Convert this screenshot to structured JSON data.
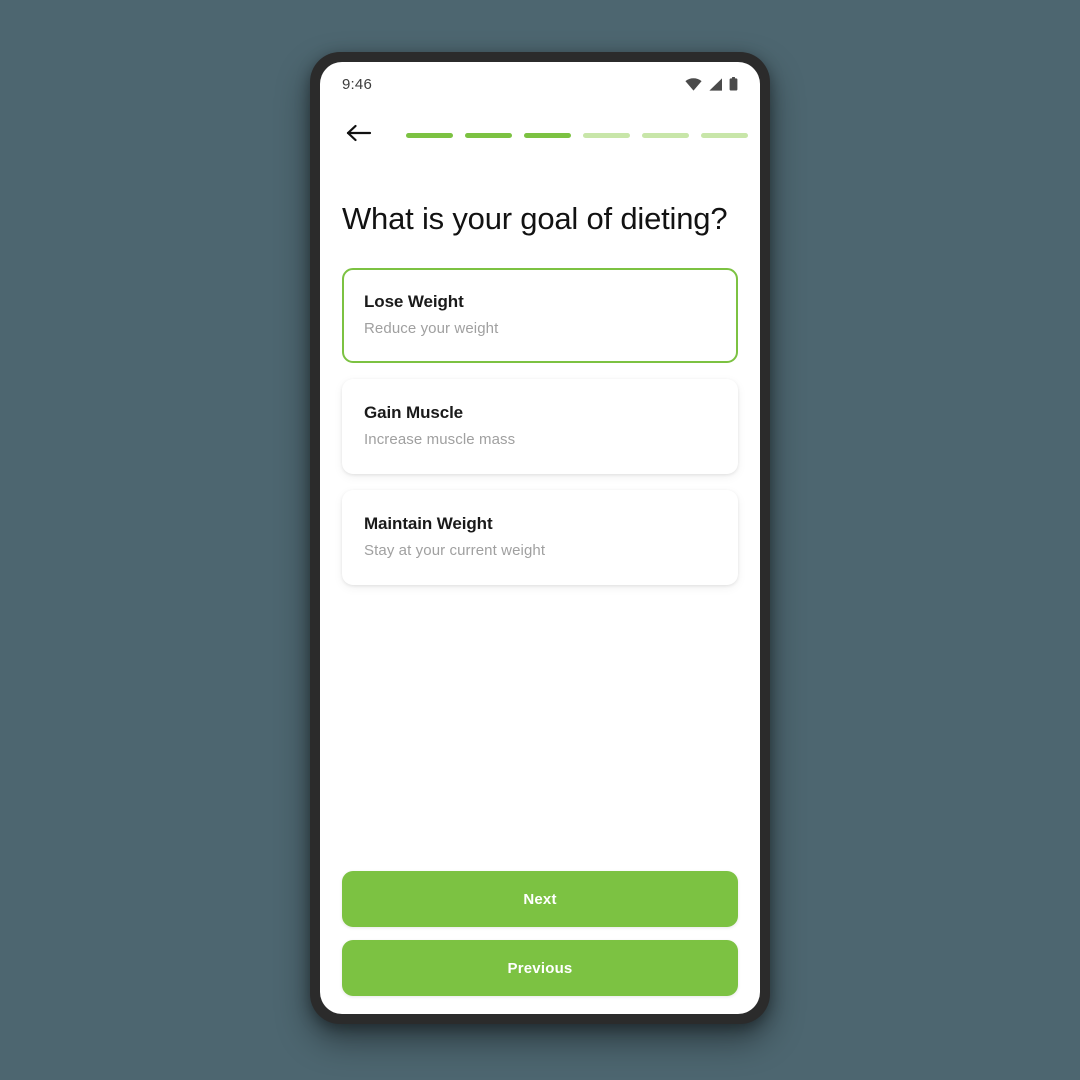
{
  "theme": {
    "page_background": "#4D6670",
    "accent_green": "#7CC242",
    "accent_green_muted": "#C8E6A9",
    "title_color": "#121212",
    "subtitle_color": "#A0A0A0"
  },
  "status_bar": {
    "time": "9:46",
    "icons": [
      "wifi-icon",
      "cellular-signal-icon",
      "battery-icon"
    ]
  },
  "top_bar": {
    "back_icon": "arrow-left-icon",
    "progress": {
      "total_steps": 6,
      "completed_steps": 3,
      "segments": [
        true,
        true,
        true,
        false,
        false,
        false
      ]
    }
  },
  "main": {
    "title": "What is your goal of dieting?",
    "options": [
      {
        "title": "Lose Weight",
        "subtitle": "Reduce your weight",
        "selected": true
      },
      {
        "title": "Gain Muscle",
        "subtitle": "Increase muscle mass",
        "selected": false
      },
      {
        "title": "Maintain Weight",
        "subtitle": "Stay at your current weight",
        "selected": false
      }
    ]
  },
  "footer": {
    "next_label": "Next",
    "previous_label": "Previous"
  }
}
